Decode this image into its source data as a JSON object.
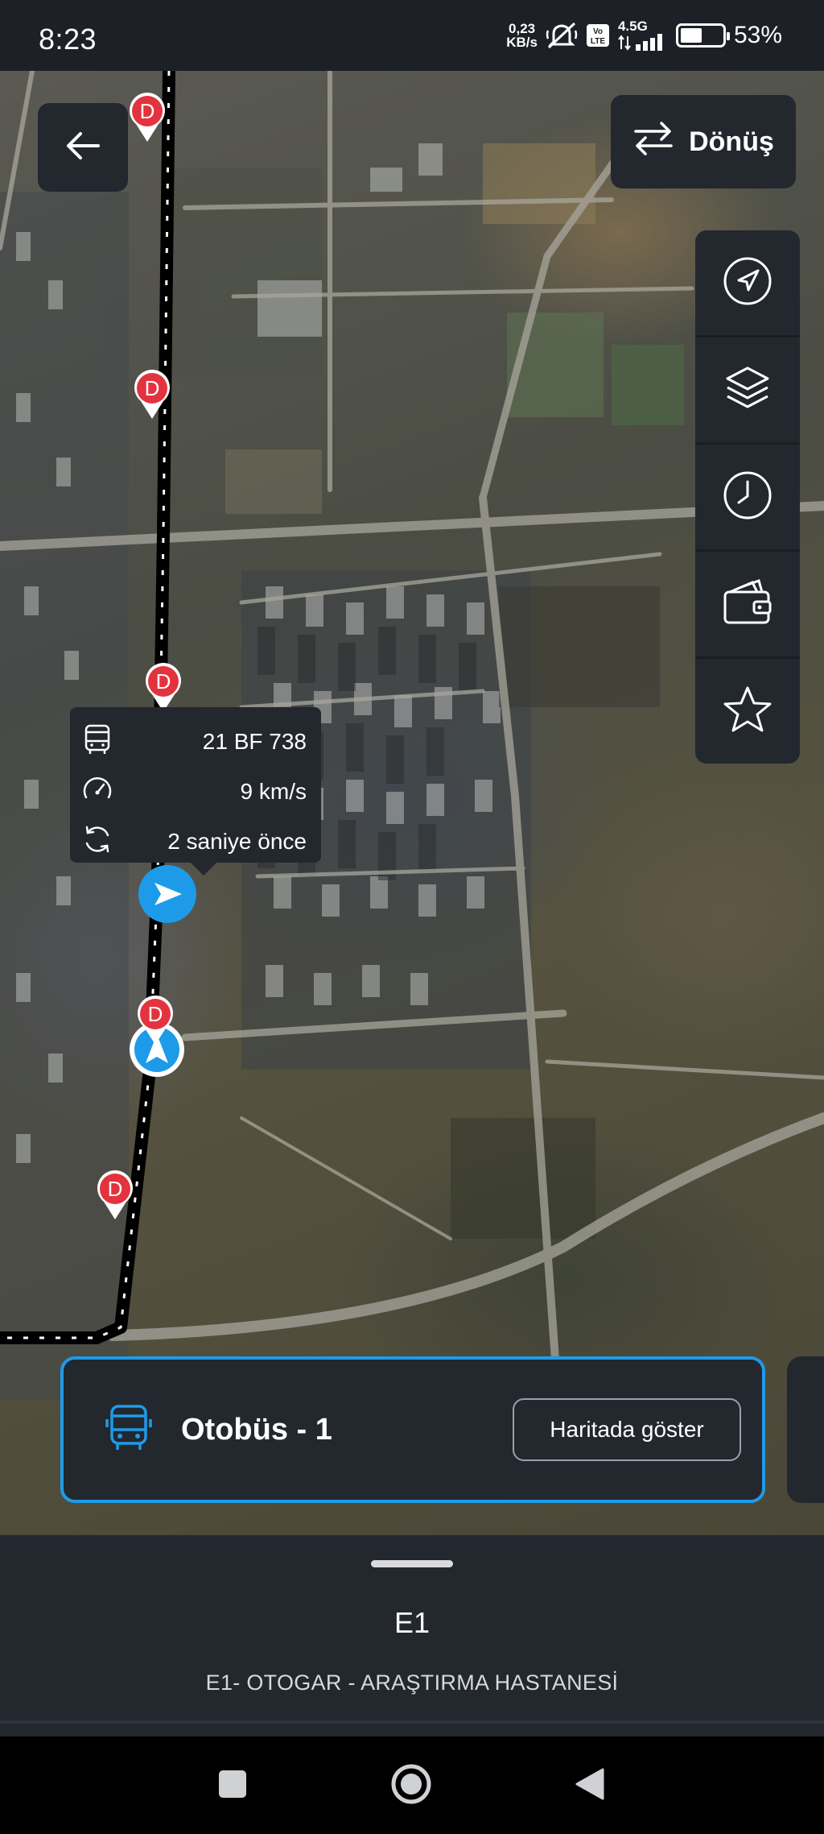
{
  "status_bar": {
    "time": "8:23",
    "net_speed_value": "0,23",
    "net_speed_unit": "KB/s",
    "network": "4.5G",
    "volte": "Vo LTE",
    "battery_percent": "53%",
    "battery_level": 0.53,
    "icons": [
      "mute-icon",
      "volte-icon",
      "signal-icon",
      "battery-icon"
    ]
  },
  "map": {
    "back_button_icon": "arrow-left-icon",
    "donus_button": {
      "label": "Dönüş",
      "icon": "swap-arrows-icon"
    },
    "side_tools": [
      {
        "icon": "navigation-arrow-icon",
        "name": "locate"
      },
      {
        "icon": "layers-icon",
        "name": "layers"
      },
      {
        "icon": "clock-icon",
        "name": "schedule"
      },
      {
        "icon": "wallet-icon",
        "name": "fare"
      },
      {
        "icon": "star-icon",
        "name": "favorite"
      }
    ],
    "stop_marker_letter": "D",
    "bus_info": {
      "plate": "21 BF 738",
      "speed": "9 km/s",
      "updated": "2 saniye önce"
    }
  },
  "route_card": {
    "title": "Otobüs - 1",
    "show_button": "Haritada göster",
    "accent_color": "#1e9be8"
  },
  "bottom_sheet": {
    "line_code": "E1",
    "line_name": "E1- OTOGAR - ARAŞTIRMA HASTANESİ"
  },
  "colors": {
    "panel": "#23272e",
    "accent": "#1e9be8",
    "stop_red": "#e2333f"
  }
}
